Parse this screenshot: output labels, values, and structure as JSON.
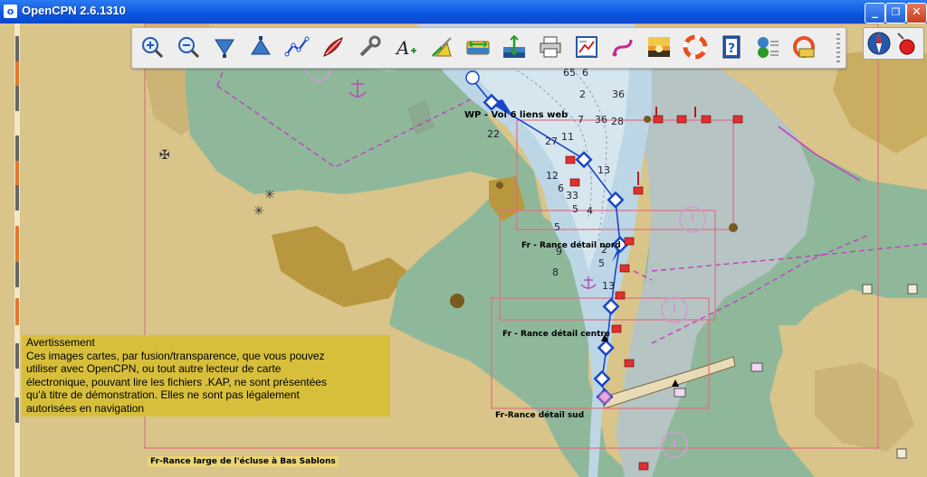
{
  "window": {
    "title": "OpenCPN 2.6.1310",
    "controls": {
      "minimize": "_",
      "maximize": "❐",
      "close": "✕"
    }
  },
  "toolbar": {
    "tools": [
      {
        "name": "zoom-in-icon"
      },
      {
        "name": "zoom-out-icon"
      },
      {
        "name": "scale-down-icon"
      },
      {
        "name": "scale-up-icon"
      },
      {
        "name": "route-icon"
      },
      {
        "name": "auto-follow-icon"
      },
      {
        "name": "options-icon"
      },
      {
        "name": "text-icon"
      },
      {
        "name": "current-icon"
      },
      {
        "name": "tide-icon"
      },
      {
        "name": "depth-icon"
      },
      {
        "name": "print-icon"
      },
      {
        "name": "route-manager-icon"
      },
      {
        "name": "track-icon"
      },
      {
        "name": "color-scheme-icon"
      },
      {
        "name": "mob-icon"
      },
      {
        "name": "help-icon"
      },
      {
        "name": "ais-icon"
      },
      {
        "name": "plugin-icon"
      }
    ]
  },
  "colors": {
    "land": "#d9c48a",
    "green_land": "#8fb89a",
    "shallow": "#bcd6e6",
    "deep": "#d6e6ee",
    "river_gray": "#b6c4c4",
    "dark_land": "#b8973e",
    "route_blue": "#1846c8",
    "chart_border": "#e07080",
    "boundary": "#c040c0"
  },
  "warning": {
    "title": "Avertissement",
    "lines": [
      "Ces images cartes, par fusion/transparence, que vous pouvez",
      "utiliser avec OpenCPN, ou tout autre lecteur de carte",
      "électronique, pouvant lire les fichiers .KAP, ne sont présentées",
      "qu'à titre de démonstration. Elles ne sont pas légalement",
      "autorisées en navigation"
    ]
  },
  "chart_labels": {
    "nord": "Fr - Rance détail nord",
    "centre": "Fr - Rance détail centre",
    "sud": "Fr-Rance détail sud",
    "large": "Fr-Rance large  de l'écluse à Bas Sablons"
  },
  "waypoint": {
    "label": "WP - Voi 6 liens web"
  },
  "soundings": [
    "65",
    "6",
    "36",
    "2",
    "36",
    "28",
    "7",
    "27",
    "11",
    "33",
    "13",
    "22",
    "12",
    "4",
    "2",
    "5",
    "13",
    "5",
    "6",
    "9",
    "8",
    "5"
  ]
}
